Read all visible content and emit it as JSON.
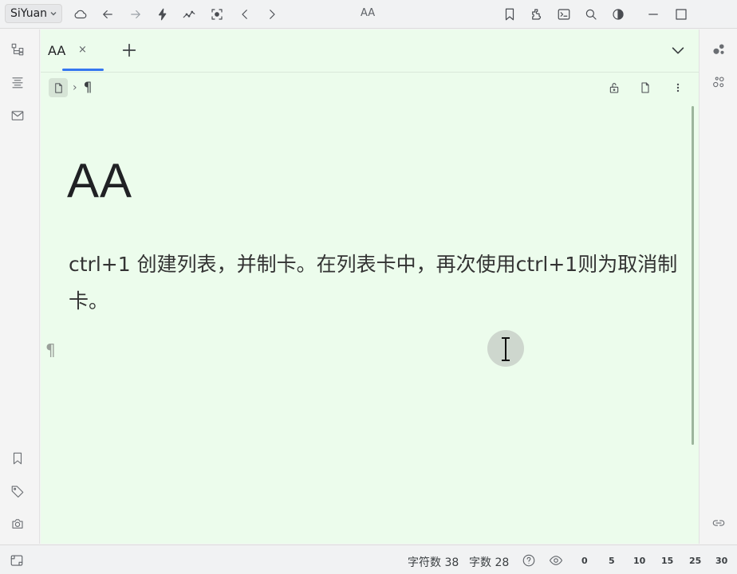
{
  "topbar": {
    "workspace": "SiYuan",
    "title": "AA",
    "icons": [
      "chevron-down-icon",
      "cloud-icon",
      "back-icon",
      "forward-icon",
      "lightning-icon",
      "graph-icon",
      "focus-icon",
      "prev-icon",
      "next-icon",
      "bookmark-icon",
      "plugin-icon",
      "terminal-icon",
      "search-icon",
      "contrast-icon",
      "minimize-icon",
      "maximize-icon"
    ]
  },
  "tabs": [
    {
      "label": "AA",
      "close": "×"
    }
  ],
  "breadcrumb": {
    "separator": "›",
    "block": "¶"
  },
  "document": {
    "title": "AA",
    "paragraph": "ctrl+1 创建列表，并制卡。在列表卡中，再次使用ctrl+1则为取消制卡。",
    "empty_block_marker": "¶"
  },
  "status": {
    "char_count_label": "字符数 38",
    "word_count_label": "字数 28",
    "help_icon": "?",
    "scale": [
      "0",
      "5",
      "10",
      "15",
      "25",
      "30"
    ]
  },
  "colors": {
    "editor_bg": "#ecfcec",
    "accent": "#3576f0"
  }
}
